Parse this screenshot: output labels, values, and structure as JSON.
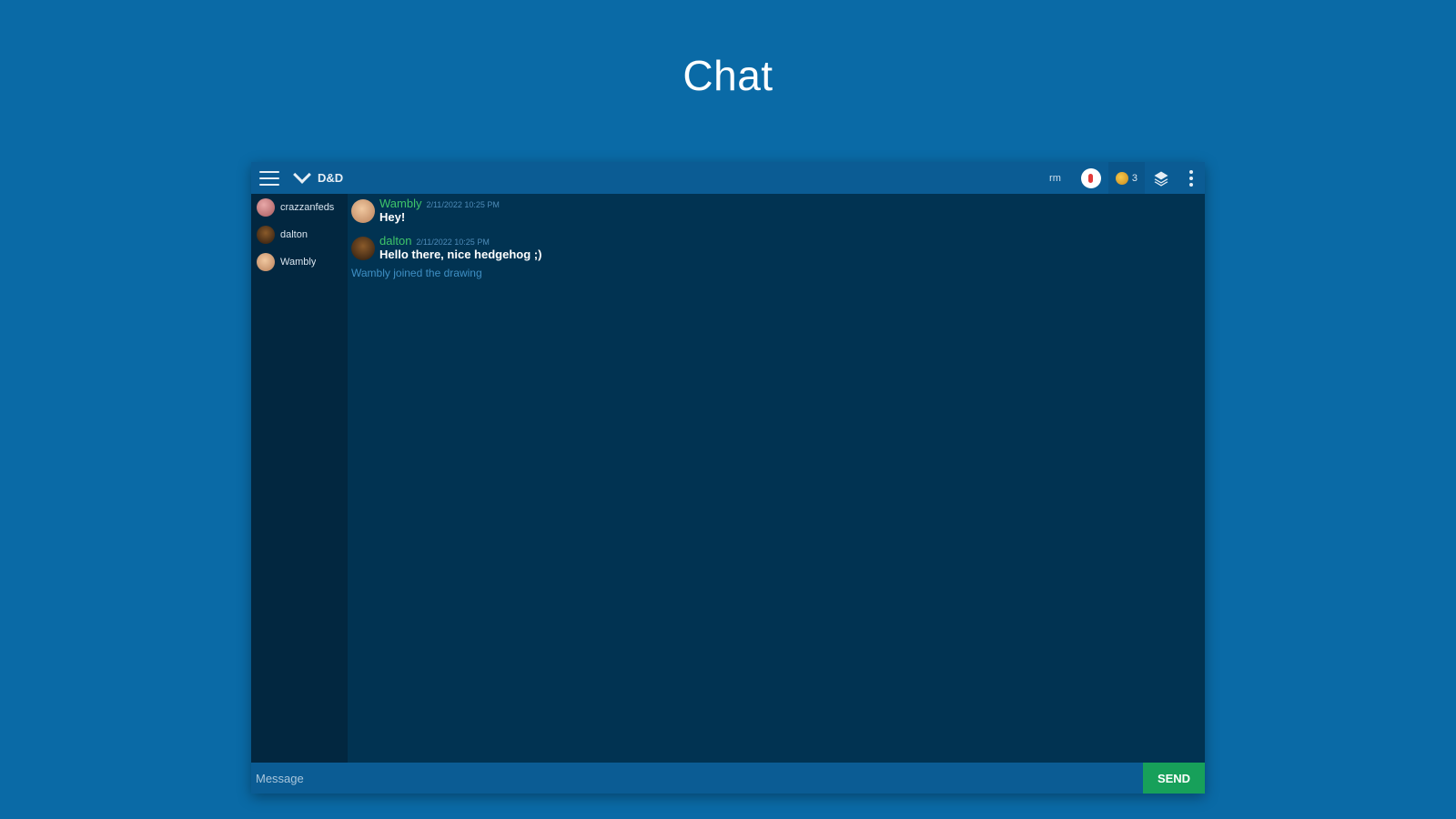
{
  "page": {
    "title": "Chat"
  },
  "topbar": {
    "menu_icon": "hamburger-menu-icon",
    "room_icon": "chevron-down-icon",
    "room_name": "D&D",
    "pen_size": "rm",
    "record_icon": "record-icon",
    "users_icon": "user-avatar-icon",
    "users_count": "3",
    "layers_icon": "layers-icon",
    "more_icon": "more-vertical-icon"
  },
  "sidebar": {
    "users": [
      {
        "name": "crazzanfeds",
        "avatar_color": "#c9777a"
      },
      {
        "name": "dalton",
        "avatar_color": "#3a2a1a"
      },
      {
        "name": "Wambly",
        "avatar_color": "#d8a47e"
      }
    ]
  },
  "chat": {
    "messages": [
      {
        "author": "Wambly",
        "time": "2/11/2022 10:25 PM",
        "text": "Hey!",
        "avatar_color": "#d8a47e"
      },
      {
        "author": "dalton",
        "time": "2/11/2022 10:25 PM",
        "text": "Hello there, nice hedgehog ;)",
        "avatar_color": "#3a2a1a"
      }
    ],
    "system_message": "Wambly joined the drawing"
  },
  "composer": {
    "placeholder": "Message",
    "send_label": "SEND"
  },
  "colors": {
    "background": "#0a6aa6",
    "topbar": "#0b5c94",
    "chat_area": "#013352",
    "sidebar": "#022740",
    "author_green": "#3ec46a",
    "send_button": "#17a05a"
  }
}
